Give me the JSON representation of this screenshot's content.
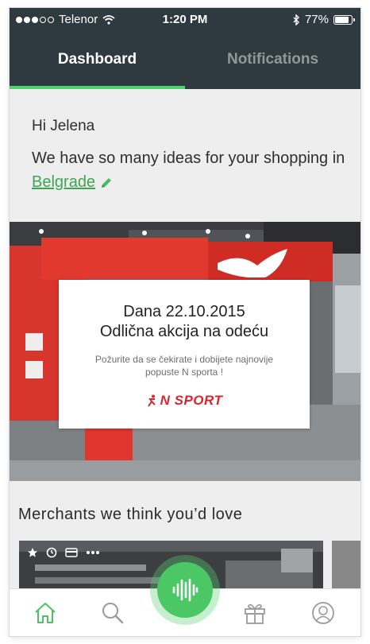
{
  "status_bar": {
    "carrier": "Telenor",
    "time": "1:20 PM",
    "battery": "77%"
  },
  "tabs": [
    {
      "label": "Dashboard",
      "active": true
    },
    {
      "label": "Notifications",
      "active": false
    }
  ],
  "greeting": {
    "name_line": "Hi Jelena",
    "text": "We have so many ideas for your shopping in ",
    "city": "Belgrade"
  },
  "promo": {
    "title_line1": "Dana 22.10.2015",
    "title_line2": "Odlična akcija na odeću",
    "subtitle": "Požurite da se čekirate i dobijete najnovije popuste N sporta !",
    "brand": "N SPORT"
  },
  "merchants": {
    "title": "Merchants we think you’d love"
  },
  "bottom_nav": [
    {
      "icon": "home-icon",
      "active": true
    },
    {
      "icon": "search-icon",
      "active": false
    },
    {
      "icon": "voice-icon",
      "active": false
    },
    {
      "icon": "gift-icon",
      "active": false
    },
    {
      "icon": "profile-icon",
      "active": false
    }
  ],
  "colors": {
    "header_bg": "#2f3940",
    "accent_green": "#4cd36b",
    "brand_red": "#d8262c"
  }
}
